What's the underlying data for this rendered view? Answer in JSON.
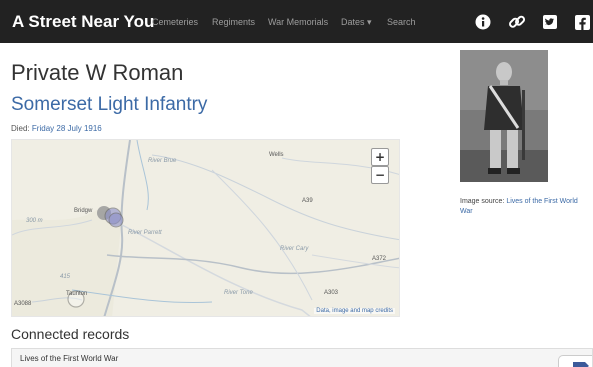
{
  "navbar": {
    "brand": "A Street Near You",
    "links": [
      "Cemeteries",
      "Regiments",
      "War Memorials",
      "Dates ▾",
      "Search"
    ],
    "icons": [
      "info-icon",
      "link-icon",
      "twitter-icon",
      "facebook-icon"
    ]
  },
  "person": {
    "name": "Private W Roman",
    "regiment": "Somerset Light Infantry",
    "died_label": "Died:",
    "died_date": "Friday 28 July 1916"
  },
  "map": {
    "zoom_in": "+",
    "zoom_out": "−",
    "attribution": "Data, image and map credits",
    "labels": {
      "wells": "Wells",
      "bridgwater": "Bridgw",
      "taunton": "Taunton",
      "river_brue": "River Brue",
      "river_cary": "River Cary",
      "river_parrett": "River Parrett",
      "river_tone": "River Tone",
      "a303": "A303",
      "a39": "A39",
      "a372": "A372",
      "a3088": "A3088",
      "height_300": "300 m",
      "height_415": "415"
    }
  },
  "image": {
    "source_prefix": "Image source:",
    "source_link": "Lives of the First World War"
  },
  "connected": {
    "heading": "Connected records",
    "records": [
      {
        "title": "Lives of the First World War"
      }
    ]
  },
  "colors": {
    "navbar": "#222222",
    "link": "#3c6aa6",
    "map_land": "#f0eee4",
    "marker": "#8c8fc8"
  }
}
